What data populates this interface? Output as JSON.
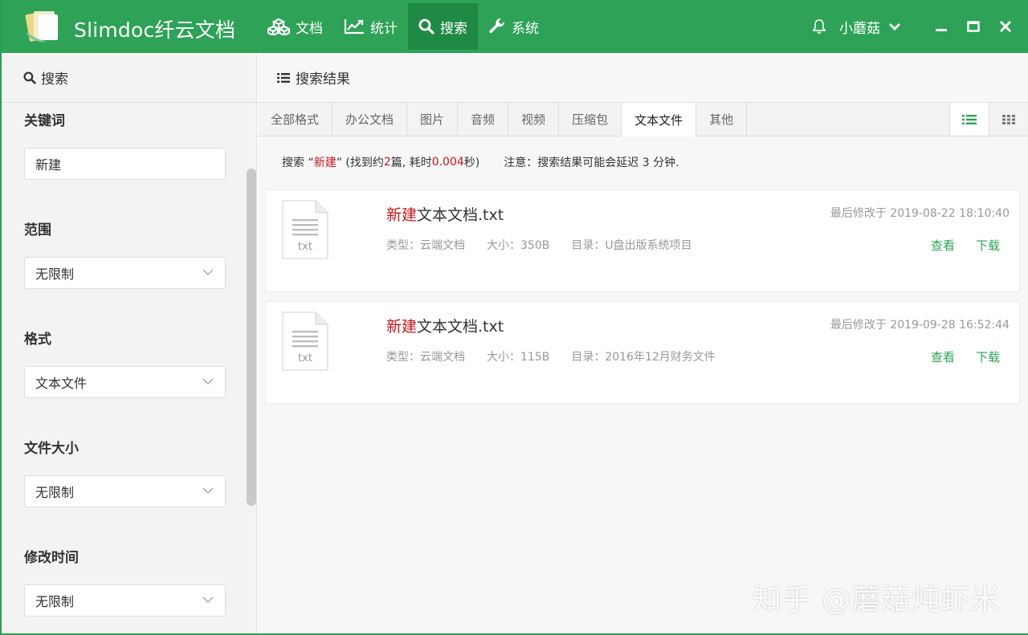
{
  "app": {
    "brand": "Slimdoc纤云文档"
  },
  "nav": [
    {
      "label": "文档",
      "icon": "cubes-icon"
    },
    {
      "label": "统计",
      "icon": "line-chart-icon"
    },
    {
      "label": "搜索",
      "icon": "search-icon",
      "active": true
    },
    {
      "label": "系统",
      "icon": "wrench-icon"
    }
  ],
  "user": {
    "name": "小蘑菇"
  },
  "sidebar": {
    "title": "搜索",
    "keyword": {
      "label": "关键词",
      "value": "新建"
    },
    "scope": {
      "label": "范围",
      "value": "无限制"
    },
    "format": {
      "label": "格式",
      "value": "文本文件"
    },
    "size": {
      "label": "文件大小",
      "value": "无限制"
    },
    "mtime": {
      "label": "修改时间",
      "value": "无限制"
    }
  },
  "main": {
    "title": "搜索结果",
    "tabs": [
      "全部格式",
      "办公文档",
      "图片",
      "音频",
      "视频",
      "压缩包",
      "文本文件",
      "其他"
    ],
    "active_tab": 6,
    "info": {
      "prefix": "搜索 “",
      "keyword": "新建",
      "mid1": "” (找到约 ",
      "count": "2",
      "mid2": "篇, 耗时 ",
      "time": "0.004",
      "suffix": " 秒)",
      "notice": "注意：搜索结果可能会延迟 3 分钟."
    },
    "results": [
      {
        "name_hl": "新建",
        "name_rest": "文本文档.txt",
        "icon_label": "txt",
        "type": "类型：云端文档",
        "size": "大小：350B",
        "dir": "目录：U盘出版系统项目",
        "mtime": "最后修改于 2019-08-22 18:10:40",
        "view": "查看",
        "download": "下载"
      },
      {
        "name_hl": "新建",
        "name_rest": "文本文档.txt",
        "icon_label": "txt",
        "type": "类型：云端文档",
        "size": "大小：115B",
        "dir": "目录：2016年12月财务文件",
        "mtime": "最后修改于 2019-09-28 16:52:44",
        "view": "查看",
        "download": "下载"
      }
    ]
  },
  "watermark": "知乎 @蘑菇炖虾米",
  "colors": {
    "brand_green": "#2ea256",
    "highlight_red": "#c8161d"
  }
}
